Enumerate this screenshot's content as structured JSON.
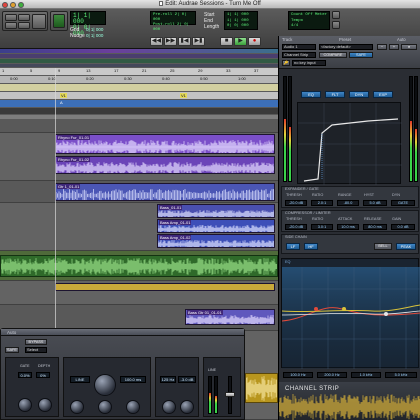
{
  "window": {
    "title": "Edit: Audrae Sessions - Turn Me Off",
    "traffic_lights": [
      "close",
      "minimize",
      "zoom"
    ]
  },
  "toolbar": {
    "counter_main": "1| 1| 000",
    "counter_sub": "0| 0| 000",
    "lcd_left_1": "Pre-roll  2| 0| 000",
    "lcd_left_2": "Post-roll 2| 0| 000",
    "start_label": "Start",
    "end_label": "End",
    "length_label": "Length",
    "start_value": "1| 1| 000",
    "end_value": "1| 1| 000",
    "length_value": "0| 0| 000",
    "nudge_label": "Nudge",
    "grid_label": "Grid",
    "grid_value": "0| 1| 000",
    "nudge_value": "0| 1| 000",
    "count_off_lcd": "Count Off  Meter  Tempo",
    "meter_value": "4/4",
    "transport_icons": [
      "rewind-icon",
      "fast-forward-icon",
      "go-to-start-icon",
      "go-to-end-icon",
      "stop-icon",
      "play-icon",
      "record-icon"
    ],
    "colors": {
      "lcd_text": "#5ef27a",
      "lcd_bg": "#0b1a10"
    }
  },
  "edit": {
    "ruler_bars": [
      "1",
      "5",
      "9",
      "13",
      "17",
      "21",
      "25",
      "29",
      "33",
      "37"
    ],
    "ruler_times": [
      "0:00",
      "0:10",
      "0:20",
      "0:30",
      "0:40",
      "0:50",
      "1:00"
    ],
    "markers": [
      "V1",
      "V1",
      "A"
    ],
    "clips": [
      {
        "name": "Rhyno Fur_01-01"
      },
      {
        "name": "Rhyno Fur_01-02"
      },
      {
        "name": "Gtr 1_01-01"
      },
      {
        "name": "Bass_01-01"
      },
      {
        "name": "Bass Amp_01-01"
      },
      {
        "name": "Bass Amp_01-02"
      },
      {
        "name": "Bass Gtr 01_01-01"
      }
    ],
    "colors": {
      "clip_purple": "#7b4fc9",
      "clip_blue": "#3d4fb8",
      "clip_green": "#2f6a2a",
      "clip_gold": "#b8961e"
    }
  },
  "plugin_left": {
    "header": "Auto",
    "bypass_label": "BYPASS",
    "safe_label": "SAFE",
    "preset_label": "Select",
    "labels": [
      "GATE",
      "DEPTH",
      "LINE",
      "GAIN",
      "OUTPUT",
      "LINE"
    ],
    "values": [
      "0.0%",
      "0%",
      "100.0 ms",
      "125 Hz",
      "-3.0 dB"
    ]
  },
  "channel_strip": {
    "track_label": "Track",
    "preset_label": "Preset",
    "auto_label": "Auto",
    "track_value": "Audio 1",
    "preset_value": "<factory default>",
    "insert_value": "Channel Strip",
    "compare_label": "COMPARE",
    "safe_label": "SAFE",
    "key_input_label": "no key input",
    "mode_buttons": [
      "EQ",
      "FLT",
      "DYN",
      "EXP"
    ],
    "expander_gate_title": "EXPANDER / GATE",
    "expander_params": [
      "THRESH",
      "RATIO",
      "RANGE",
      "HYST",
      "DYN"
    ],
    "expander_values": [
      "-20.0 dB",
      "2.0:1",
      "-80.0",
      "5.0 dB",
      "GATE"
    ],
    "compressor_title": "COMPRESSOR / LIMITER",
    "compressor_params": [
      "THRESH",
      "RATIO",
      "ATTACK",
      "RELEASE",
      "GAIN"
    ],
    "compressor_values": [
      "-20.0 dB",
      "3.0:1",
      "10.0 ms",
      "80.0 ms",
      "0.0 dB"
    ],
    "side_chain_title": "SIDE CHAIN",
    "side_chain_buttons": [
      "LF",
      "HF",
      "BELL",
      "PEAK"
    ],
    "eq_title": "EQ",
    "band_values": [
      "100.0 Hz",
      "200.0 Hz",
      "1.0 kHz",
      "5.0 kHz"
    ],
    "footer": "CHANNEL STRIP",
    "colors": {
      "accent_blue": "#2e78bd",
      "eq_curve_red": "#e14a3a",
      "eq_curve_gold": "#d8c23a",
      "panel": "#2a2d33"
    }
  }
}
